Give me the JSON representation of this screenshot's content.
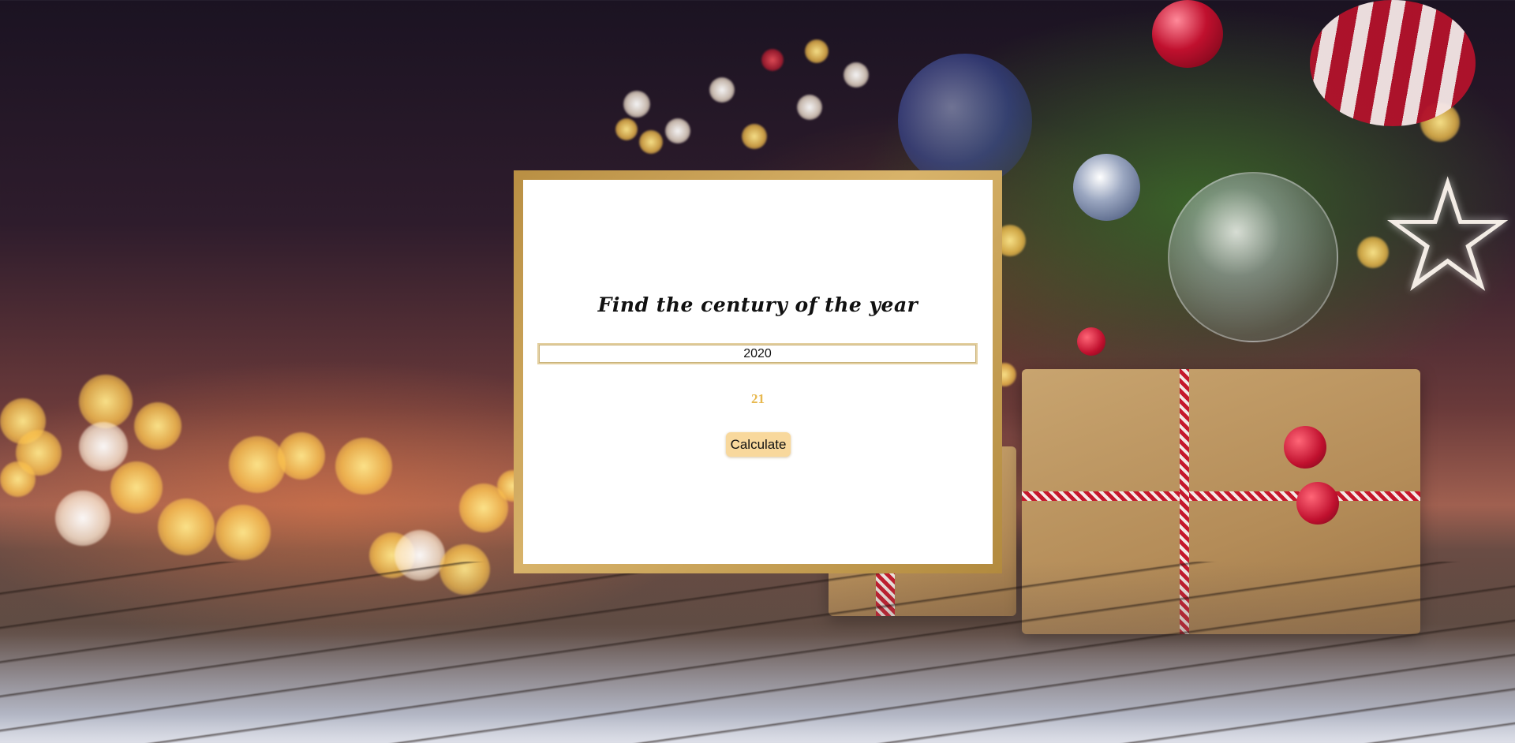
{
  "card": {
    "title": "Find the century of the year",
    "input_value": "2020",
    "result": "21",
    "button_label": "Calculate"
  },
  "background": {
    "theme": "christmas-gifts-bokeh",
    "accent_gold": "#d8b36a",
    "button_color": "#f8d89c",
    "result_color": "#e7b84e"
  }
}
